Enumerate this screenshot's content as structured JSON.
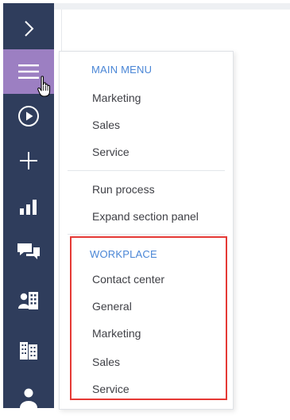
{
  "sidebar": {
    "items": [
      {
        "icon": "chevron-right-icon"
      },
      {
        "icon": "hamburger-menu-icon",
        "active": true
      },
      {
        "icon": "play-circle-icon"
      },
      {
        "icon": "plus-icon"
      },
      {
        "icon": "bar-chart-icon"
      },
      {
        "icon": "chat-icon"
      },
      {
        "icon": "contacts-icon"
      },
      {
        "icon": "building-icon"
      },
      {
        "icon": "user-icon"
      }
    ],
    "colors": {
      "background": "#2f3d5c",
      "active": "#9c7fc2"
    }
  },
  "menu": {
    "main_menu": {
      "title": "MAIN MENU",
      "items": [
        "Marketing",
        "Sales",
        "Service"
      ]
    },
    "actions": [
      "Run process",
      "Expand section panel"
    ],
    "workplace": {
      "title": "WORKPLACE",
      "items": [
        "Contact center",
        "General",
        "Marketing",
        "Sales",
        "Service"
      ]
    },
    "colors": {
      "group_title": "#4a86d6",
      "text": "#3f4046",
      "highlight_border": "#e53935"
    }
  }
}
